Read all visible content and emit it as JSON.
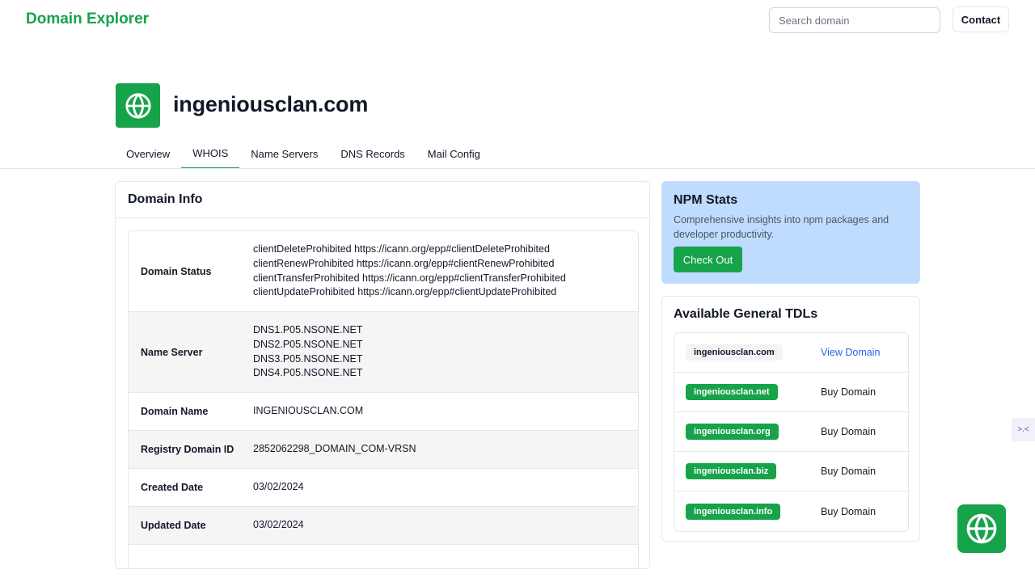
{
  "header": {
    "brand": "Domain Explorer",
    "search_placeholder": "Search domain",
    "contact_label": "Contact"
  },
  "domain": {
    "title": "ingeniousclan.com"
  },
  "tabs": [
    {
      "label": "Overview",
      "active": false
    },
    {
      "label": "WHOIS",
      "active": true
    },
    {
      "label": "Name Servers",
      "active": false
    },
    {
      "label": "DNS Records",
      "active": false
    },
    {
      "label": "Mail Config",
      "active": false
    }
  ],
  "domain_info": {
    "title": "Domain Info",
    "rows": [
      {
        "key": "Domain Status",
        "lines": [
          "clientDeleteProhibited https://icann.org/epp#clientDeleteProhibited",
          "clientRenewProhibited https://icann.org/epp#clientRenewProhibited",
          "clientTransferProhibited https://icann.org/epp#clientTransferProhibited",
          "clientUpdateProhibited https://icann.org/epp#clientUpdateProhibited"
        ]
      },
      {
        "key": "Name Server",
        "lines": [
          "DNS1.P05.NSONE.NET",
          "DNS2.P05.NSONE.NET",
          "DNS3.P05.NSONE.NET",
          "DNS4.P05.NSONE.NET"
        ]
      },
      {
        "key": "Domain Name",
        "lines": [
          "INGENIOUSCLAN.COM"
        ]
      },
      {
        "key": "Registry Domain ID",
        "lines": [
          "2852062298_DOMAIN_COM-VRSN"
        ]
      },
      {
        "key": "Created Date",
        "lines": [
          "03/02/2024"
        ]
      },
      {
        "key": "Updated Date",
        "lines": [
          "03/02/2024"
        ]
      }
    ]
  },
  "npm": {
    "title": "NPM Stats",
    "description": "Comprehensive insights into npm packages and developer productivity.",
    "button_label": "Check Out"
  },
  "tlds": {
    "title": "Available General TDLs",
    "items": [
      {
        "domain": "ingeniousclan.com",
        "action": "View Domain",
        "taken": true
      },
      {
        "domain": "ingeniousclan.net",
        "action": "Buy Domain",
        "taken": false
      },
      {
        "domain": "ingeniousclan.org",
        "action": "Buy Domain",
        "taken": false
      },
      {
        "domain": "ingeniousclan.biz",
        "action": "Buy Domain",
        "taken": false
      },
      {
        "domain": "ingeniousclan.info",
        "action": "Buy Domain",
        "taken": false
      }
    ]
  },
  "side_widget": {
    "glyph": ">.<"
  },
  "colors": {
    "brand": "#16a34a",
    "link": "#2563eb",
    "npm_bg": "#bfdbfe"
  }
}
